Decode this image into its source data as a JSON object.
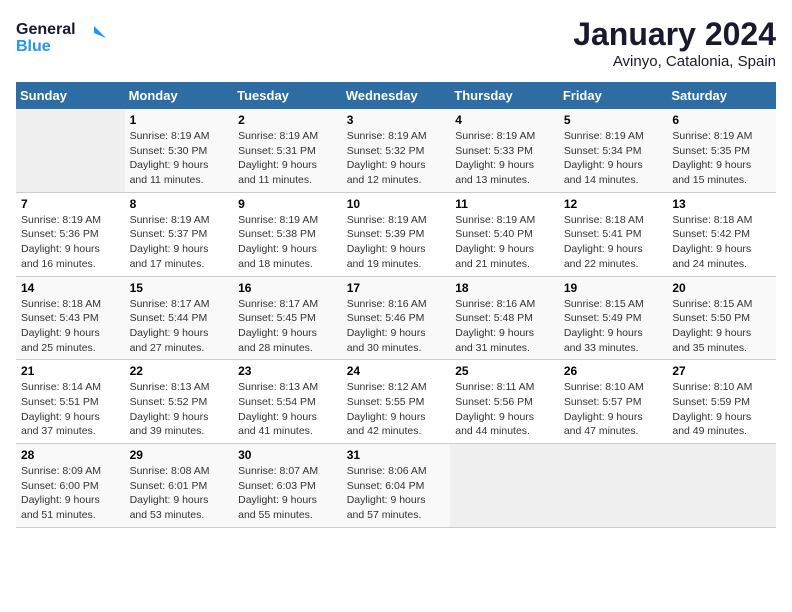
{
  "header": {
    "logo_line1": "General",
    "logo_line2": "Blue",
    "month": "January 2024",
    "location": "Avinyo, Catalonia, Spain"
  },
  "weekdays": [
    "Sunday",
    "Monday",
    "Tuesday",
    "Wednesday",
    "Thursday",
    "Friday",
    "Saturday"
  ],
  "weeks": [
    [
      {
        "day": "",
        "info": ""
      },
      {
        "day": "1",
        "info": "Sunrise: 8:19 AM\nSunset: 5:30 PM\nDaylight: 9 hours\nand 11 minutes."
      },
      {
        "day": "2",
        "info": "Sunrise: 8:19 AM\nSunset: 5:31 PM\nDaylight: 9 hours\nand 11 minutes."
      },
      {
        "day": "3",
        "info": "Sunrise: 8:19 AM\nSunset: 5:32 PM\nDaylight: 9 hours\nand 12 minutes."
      },
      {
        "day": "4",
        "info": "Sunrise: 8:19 AM\nSunset: 5:33 PM\nDaylight: 9 hours\nand 13 minutes."
      },
      {
        "day": "5",
        "info": "Sunrise: 8:19 AM\nSunset: 5:34 PM\nDaylight: 9 hours\nand 14 minutes."
      },
      {
        "day": "6",
        "info": "Sunrise: 8:19 AM\nSunset: 5:35 PM\nDaylight: 9 hours\nand 15 minutes."
      }
    ],
    [
      {
        "day": "7",
        "info": "Sunrise: 8:19 AM\nSunset: 5:36 PM\nDaylight: 9 hours\nand 16 minutes."
      },
      {
        "day": "8",
        "info": "Sunrise: 8:19 AM\nSunset: 5:37 PM\nDaylight: 9 hours\nand 17 minutes."
      },
      {
        "day": "9",
        "info": "Sunrise: 8:19 AM\nSunset: 5:38 PM\nDaylight: 9 hours\nand 18 minutes."
      },
      {
        "day": "10",
        "info": "Sunrise: 8:19 AM\nSunset: 5:39 PM\nDaylight: 9 hours\nand 19 minutes."
      },
      {
        "day": "11",
        "info": "Sunrise: 8:19 AM\nSunset: 5:40 PM\nDaylight: 9 hours\nand 21 minutes."
      },
      {
        "day": "12",
        "info": "Sunrise: 8:18 AM\nSunset: 5:41 PM\nDaylight: 9 hours\nand 22 minutes."
      },
      {
        "day": "13",
        "info": "Sunrise: 8:18 AM\nSunset: 5:42 PM\nDaylight: 9 hours\nand 24 minutes."
      }
    ],
    [
      {
        "day": "14",
        "info": "Sunrise: 8:18 AM\nSunset: 5:43 PM\nDaylight: 9 hours\nand 25 minutes."
      },
      {
        "day": "15",
        "info": "Sunrise: 8:17 AM\nSunset: 5:44 PM\nDaylight: 9 hours\nand 27 minutes."
      },
      {
        "day": "16",
        "info": "Sunrise: 8:17 AM\nSunset: 5:45 PM\nDaylight: 9 hours\nand 28 minutes."
      },
      {
        "day": "17",
        "info": "Sunrise: 8:16 AM\nSunset: 5:46 PM\nDaylight: 9 hours\nand 30 minutes."
      },
      {
        "day": "18",
        "info": "Sunrise: 8:16 AM\nSunset: 5:48 PM\nDaylight: 9 hours\nand 31 minutes."
      },
      {
        "day": "19",
        "info": "Sunrise: 8:15 AM\nSunset: 5:49 PM\nDaylight: 9 hours\nand 33 minutes."
      },
      {
        "day": "20",
        "info": "Sunrise: 8:15 AM\nSunset: 5:50 PM\nDaylight: 9 hours\nand 35 minutes."
      }
    ],
    [
      {
        "day": "21",
        "info": "Sunrise: 8:14 AM\nSunset: 5:51 PM\nDaylight: 9 hours\nand 37 minutes."
      },
      {
        "day": "22",
        "info": "Sunrise: 8:13 AM\nSunset: 5:52 PM\nDaylight: 9 hours\nand 39 minutes."
      },
      {
        "day": "23",
        "info": "Sunrise: 8:13 AM\nSunset: 5:54 PM\nDaylight: 9 hours\nand 41 minutes."
      },
      {
        "day": "24",
        "info": "Sunrise: 8:12 AM\nSunset: 5:55 PM\nDaylight: 9 hours\nand 42 minutes."
      },
      {
        "day": "25",
        "info": "Sunrise: 8:11 AM\nSunset: 5:56 PM\nDaylight: 9 hours\nand 44 minutes."
      },
      {
        "day": "26",
        "info": "Sunrise: 8:10 AM\nSunset: 5:57 PM\nDaylight: 9 hours\nand 47 minutes."
      },
      {
        "day": "27",
        "info": "Sunrise: 8:10 AM\nSunset: 5:59 PM\nDaylight: 9 hours\nand 49 minutes."
      }
    ],
    [
      {
        "day": "28",
        "info": "Sunrise: 8:09 AM\nSunset: 6:00 PM\nDaylight: 9 hours\nand 51 minutes."
      },
      {
        "day": "29",
        "info": "Sunrise: 8:08 AM\nSunset: 6:01 PM\nDaylight: 9 hours\nand 53 minutes."
      },
      {
        "day": "30",
        "info": "Sunrise: 8:07 AM\nSunset: 6:03 PM\nDaylight: 9 hours\nand 55 minutes."
      },
      {
        "day": "31",
        "info": "Sunrise: 8:06 AM\nSunset: 6:04 PM\nDaylight: 9 hours\nand 57 minutes."
      },
      {
        "day": "",
        "info": ""
      },
      {
        "day": "",
        "info": ""
      },
      {
        "day": "",
        "info": ""
      }
    ]
  ]
}
